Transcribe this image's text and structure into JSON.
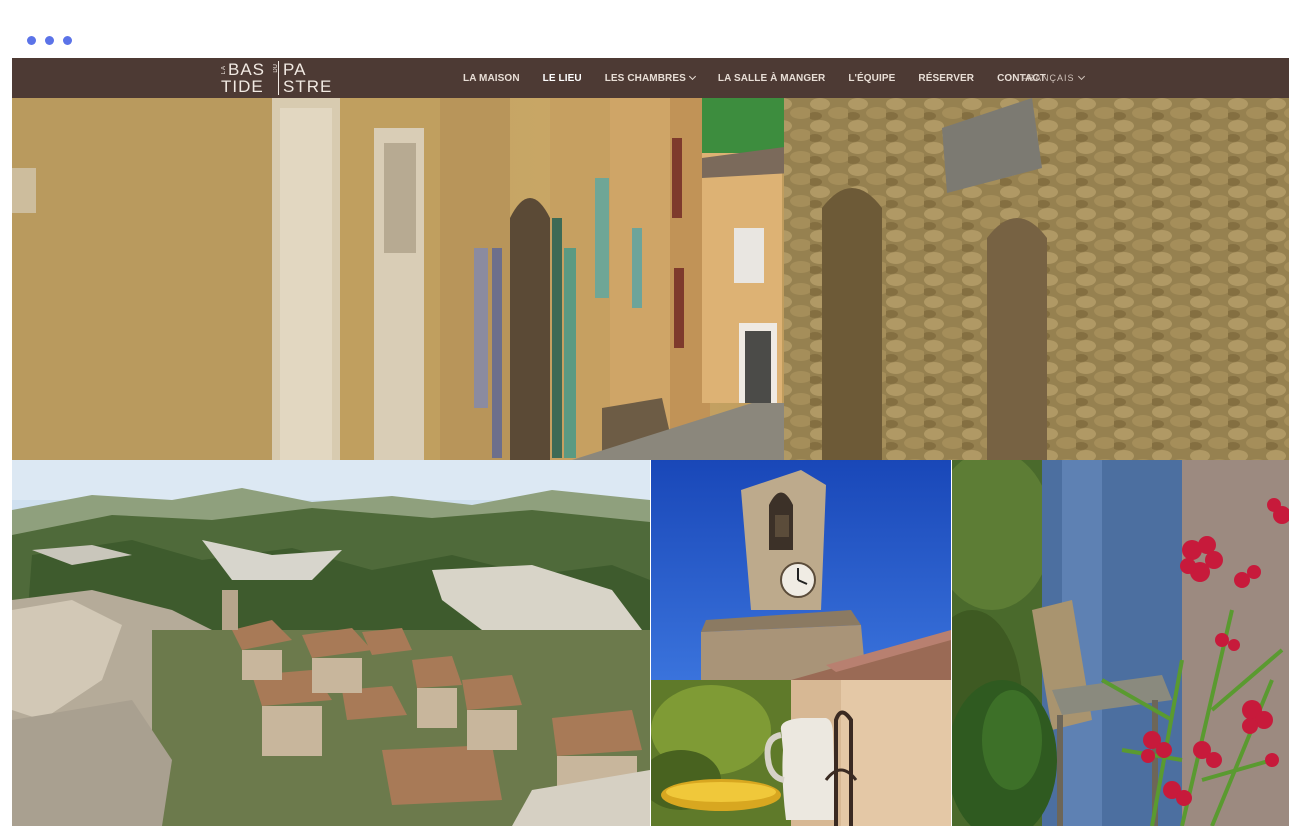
{
  "logo": {
    "row1_mini": "LA",
    "row1": "BAS",
    "row2": "TIDE",
    "mid_mini": "DU",
    "right1": "PA",
    "right2": "STRE"
  },
  "nav": {
    "items": [
      {
        "label": "LA MAISON",
        "active": false,
        "dropdown": false
      },
      {
        "label": "LE LIEU",
        "active": true,
        "dropdown": false
      },
      {
        "label": "LES CHAMBRES",
        "active": false,
        "dropdown": true
      },
      {
        "label": "LA SALLE À MANGER",
        "active": false,
        "dropdown": false
      },
      {
        "label": "L'ÉQUIPE",
        "active": false,
        "dropdown": false
      },
      {
        "label": "RÉSERVER",
        "active": false,
        "dropdown": false
      },
      {
        "label": "CONTACT",
        "active": false,
        "dropdown": false
      }
    ],
    "language": "FRANÇAIS"
  },
  "colors": {
    "nav_bg": "#4d3a34",
    "window_dots": "#5b73e8"
  },
  "photos": {
    "hero": "village-street-photo",
    "landscape": "hillside-village-photo",
    "clocktower": "clock-tower-photo",
    "pitcher": "pitcher-still-life-photo",
    "flowers": "oleander-flowers-photo"
  }
}
